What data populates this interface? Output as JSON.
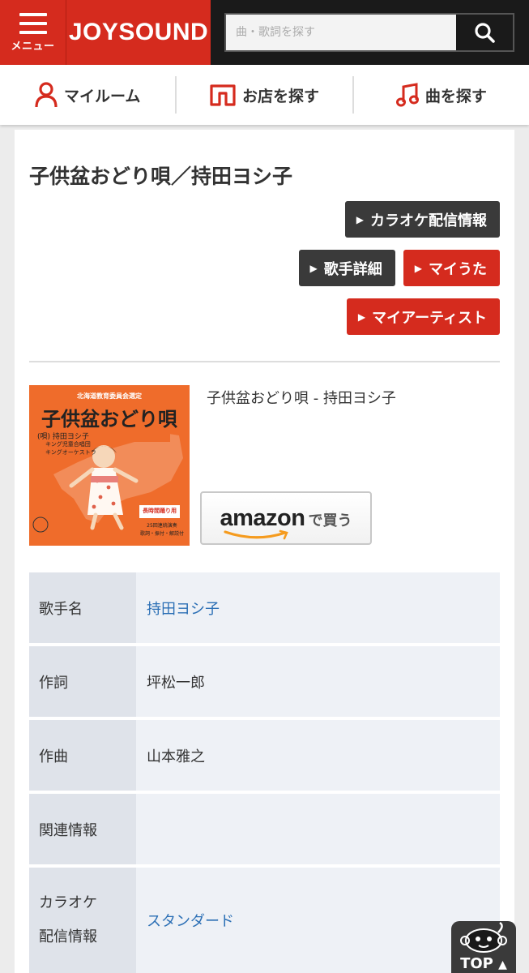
{
  "header": {
    "menu_label": "メニュー",
    "logo_text": "JOYSOUND",
    "search_placeholder": "曲・歌詞を探す",
    "brand_color": "#d52b1e"
  },
  "nav": {
    "items": [
      {
        "label": "マイルーム",
        "icon": "person-icon"
      },
      {
        "label": "お店を探す",
        "icon": "shop-icon"
      },
      {
        "label": "曲を探す",
        "icon": "music-note-icon"
      }
    ]
  },
  "song": {
    "title": "子供盆おどり唄／持田ヨシ子",
    "product_name": "子供盆おどり唄 - 持田ヨシ子"
  },
  "buttons": {
    "karaoke_info": "カラオケ配信情報",
    "artist_detail": "歌手詳細",
    "my_uta": "マイうた",
    "my_artist": "マイアーティスト"
  },
  "jacket": {
    "top_caption": "北海道教育委員会選定",
    "title": "子供盆おどり唄",
    "singer": "(唄) 持田ヨシ子",
    "chorus": "キング児童合唱団",
    "orchestra": "キングオーケストラ",
    "badge": "長時間踊り用",
    "note1": "25回連続演奏",
    "note2": "歌詞・振付・解説付"
  },
  "amazon": {
    "logo": "amazon",
    "suffix": "で買う"
  },
  "info": [
    {
      "label": "歌手名",
      "value": "持田ヨシ子",
      "link": true
    },
    {
      "label": "作詞",
      "value": "坪松一郎",
      "link": false
    },
    {
      "label": "作曲",
      "value": "山本雅之",
      "link": false
    },
    {
      "label": "関連情報",
      "value": "",
      "link": false
    },
    {
      "label_line1": "カラオケ",
      "label_line2": "配信情報",
      "value": "スタンダード",
      "link": true
    }
  ],
  "top_button": {
    "label": "TOP"
  }
}
